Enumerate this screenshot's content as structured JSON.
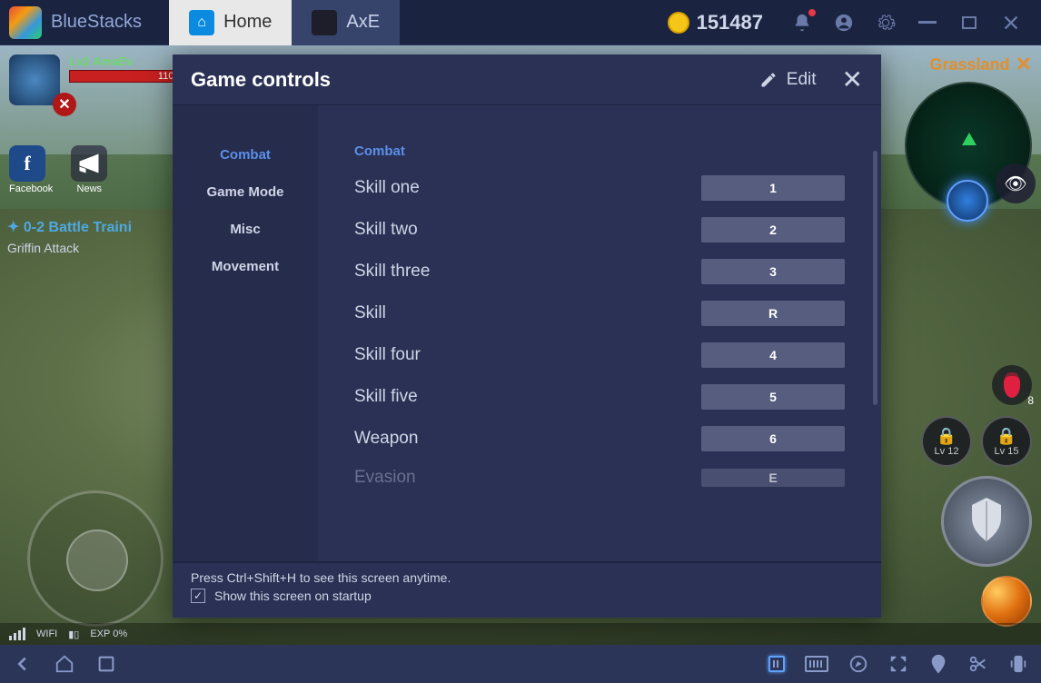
{
  "titlebar": {
    "brand": "BlueStacks",
    "tabs": {
      "home": "Home",
      "axe": "AxE"
    },
    "coins": "151487"
  },
  "hud": {
    "player_name": "Lv2 AmaEv",
    "hp_text": "110",
    "region": "Grassland",
    "social": {
      "fb": "Facebook",
      "news": "News"
    },
    "quest_title": "0-2 Battle Traini",
    "quest_sub": "Griffin Attack",
    "locks": {
      "l1": "Lv 12",
      "l2": "Lv 15"
    },
    "potion_count": "8",
    "status": {
      "wifi": "WIFI",
      "exp": "EXP 0%"
    }
  },
  "modal": {
    "title": "Game controls",
    "edit_label": "Edit",
    "categories": [
      "Combat",
      "Game Mode",
      "Misc",
      "Movement"
    ],
    "section_title": "Combat",
    "controls": [
      {
        "label": "Skill one",
        "key": "1"
      },
      {
        "label": "Skill two",
        "key": "2"
      },
      {
        "label": "Skill three",
        "key": "3"
      },
      {
        "label": "Skill",
        "key": "R"
      },
      {
        "label": "Skill four",
        "key": "4"
      },
      {
        "label": "Skill five",
        "key": "5"
      },
      {
        "label": "Weapon",
        "key": "6"
      },
      {
        "label": "Evasion",
        "key": "E"
      }
    ],
    "footer_hint": "Press Ctrl+Shift+H to see this screen anytime.",
    "checkbox_label": "Show this screen on startup",
    "checkbox_checked": true
  }
}
